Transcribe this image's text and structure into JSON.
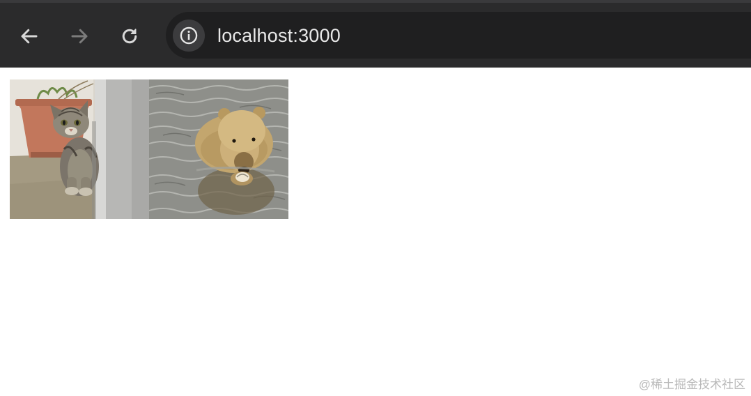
{
  "browser": {
    "url": "localhost:3000",
    "icons": {
      "back": "arrow-left-icon",
      "forward": "arrow-right-icon",
      "reload": "reload-icon",
      "site_info": "info-icon"
    }
  },
  "page": {
    "images": [
      {
        "subject": "kitten"
      },
      {
        "subject": "bear"
      }
    ]
  },
  "watermark": "@稀土掘金技术社区"
}
